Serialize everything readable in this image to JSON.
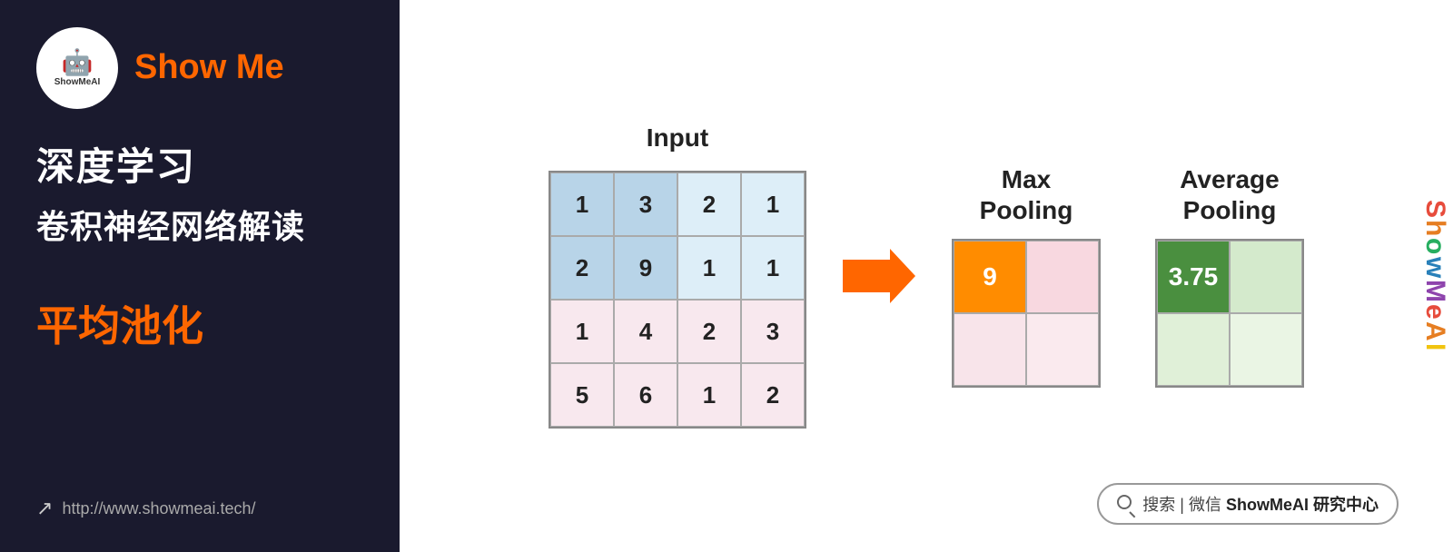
{
  "left": {
    "logo_text": "ShowMeAI",
    "show_me": "Show Me",
    "title_line1": "深度学习",
    "title_line2": "卷积神经网络解读",
    "highlight": "平均池化",
    "url": "http://www.showmeai.tech/"
  },
  "input_section": {
    "title": "Input",
    "grid": [
      [
        {
          "value": "1",
          "style": "blue-dark"
        },
        {
          "value": "3",
          "style": "blue-dark"
        },
        {
          "value": "2",
          "style": "blue-light"
        },
        {
          "value": "1",
          "style": "blue-light"
        }
      ],
      [
        {
          "value": "2",
          "style": "blue-dark"
        },
        {
          "value": "9",
          "style": "blue-dark"
        },
        {
          "value": "1",
          "style": "blue-light"
        },
        {
          "value": "1",
          "style": "blue-light"
        }
      ],
      [
        {
          "value": "1",
          "style": "pink"
        },
        {
          "value": "4",
          "style": "pink"
        },
        {
          "value": "2",
          "style": "pink"
        },
        {
          "value": "3",
          "style": "pink"
        }
      ],
      [
        {
          "value": "5",
          "style": "pink"
        },
        {
          "value": "6",
          "style": "pink"
        },
        {
          "value": "1",
          "style": "pink"
        },
        {
          "value": "2",
          "style": "pink"
        }
      ]
    ]
  },
  "max_pooling": {
    "title": "Max\nPooling",
    "grid": [
      [
        {
          "value": "9",
          "style": "orange"
        },
        {
          "value": "",
          "style": "pink"
        }
      ],
      [
        {
          "value": "",
          "style": "pink2"
        },
        {
          "value": "",
          "style": "pink3"
        }
      ]
    ]
  },
  "avg_pooling": {
    "title": "Average\nPooling",
    "grid": [
      [
        {
          "value": "3.75",
          "style": "green-dark"
        },
        {
          "value": "",
          "style": "green-light"
        }
      ],
      [
        {
          "value": "",
          "style": "green-light2"
        },
        {
          "value": "",
          "style": "green-light3"
        }
      ]
    ]
  },
  "search_bar": {
    "label": "搜索 | 微信",
    "bold": "ShowMeAI 研究中心"
  },
  "brand_vertical": "ShowMeAI"
}
